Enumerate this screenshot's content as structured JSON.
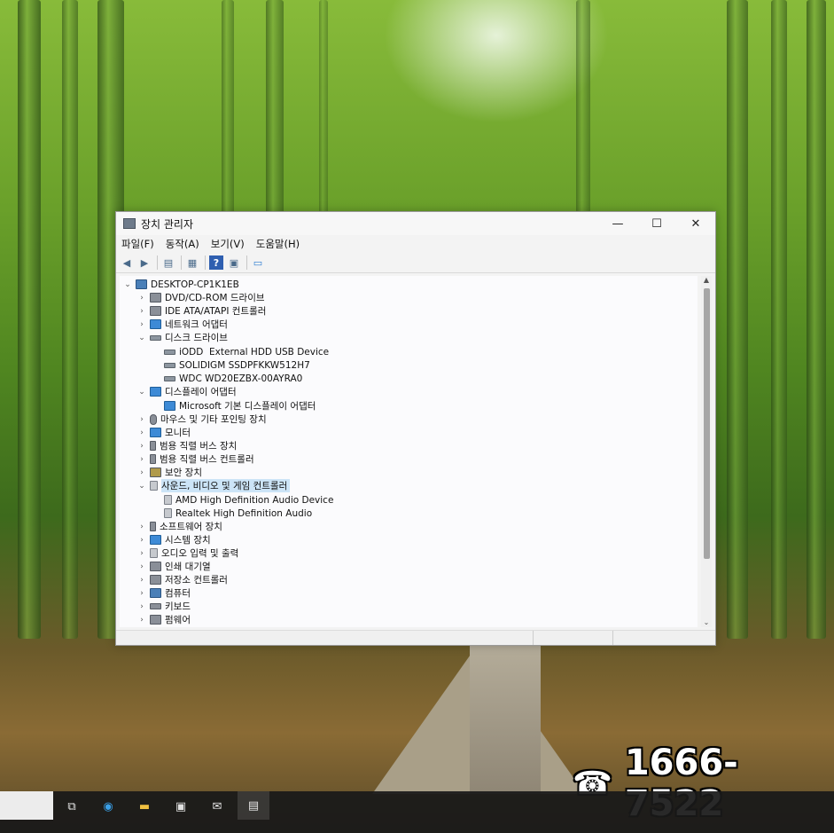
{
  "window": {
    "title": "장치 관리자",
    "minimize": "—",
    "maximize": "☐",
    "close": "✕",
    "menu": [
      "파일(F)",
      "동작(A)",
      "보기(V)",
      "도움말(H)"
    ]
  },
  "tree": {
    "root": "DESKTOP-CP1K1EB",
    "items": [
      {
        "label": "DVD/CD-ROM 드라이브",
        "expanded": false
      },
      {
        "label": "IDE ATA/ATAPI 컨트롤러",
        "expanded": false
      },
      {
        "label": "네트워크 어댑터",
        "expanded": false
      },
      {
        "label": "디스크 드라이브",
        "expanded": true
      },
      {
        "label": "iODD  External HDD USB Device",
        "child": true
      },
      {
        "label": "SOLIDIGM SSDPFKKW512H7",
        "child": true
      },
      {
        "label": "WDC WD20EZBX-00AYRA0",
        "child": true
      },
      {
        "label": "디스플레이 어댑터",
        "expanded": true
      },
      {
        "label": "Microsoft 기본 디스플레이 어댑터",
        "child": true
      },
      {
        "label": "마우스 및 기타 포인팅 장치",
        "expanded": false
      },
      {
        "label": "모니터",
        "expanded": false
      },
      {
        "label": "범용 직렬 버스 장치",
        "expanded": false
      },
      {
        "label": "범용 직렬 버스 컨트롤러",
        "expanded": false
      },
      {
        "label": "보안 장치",
        "expanded": false
      },
      {
        "label": "사운드, 비디오 및 게임 컨트롤러",
        "expanded": true,
        "selected": true
      },
      {
        "label": "AMD High Definition Audio Device",
        "child": true
      },
      {
        "label": "Realtek High Definition Audio",
        "child": true
      },
      {
        "label": "소프트웨어 장치",
        "expanded": false
      },
      {
        "label": "시스템 장치",
        "expanded": false
      },
      {
        "label": "오디오 입력 및 출력",
        "expanded": false
      },
      {
        "label": "인쇄 대기열",
        "expanded": false
      },
      {
        "label": "저장소 컨트롤러",
        "expanded": false
      },
      {
        "label": "컴퓨터",
        "expanded": false
      },
      {
        "label": "키보드",
        "expanded": false
      },
      {
        "label": "펌웨어",
        "expanded": false
      }
    ]
  },
  "overlay": {
    "phone_icon": "☎",
    "phone_number": "1666-7522"
  },
  "taskbar": {
    "icons": [
      "task-view-icon",
      "edge-icon",
      "file-explorer-icon",
      "store-icon",
      "mail-icon",
      "device-manager-icon"
    ]
  },
  "colors": {
    "selection": "#cce4f7",
    "taskbar": "#191919"
  }
}
